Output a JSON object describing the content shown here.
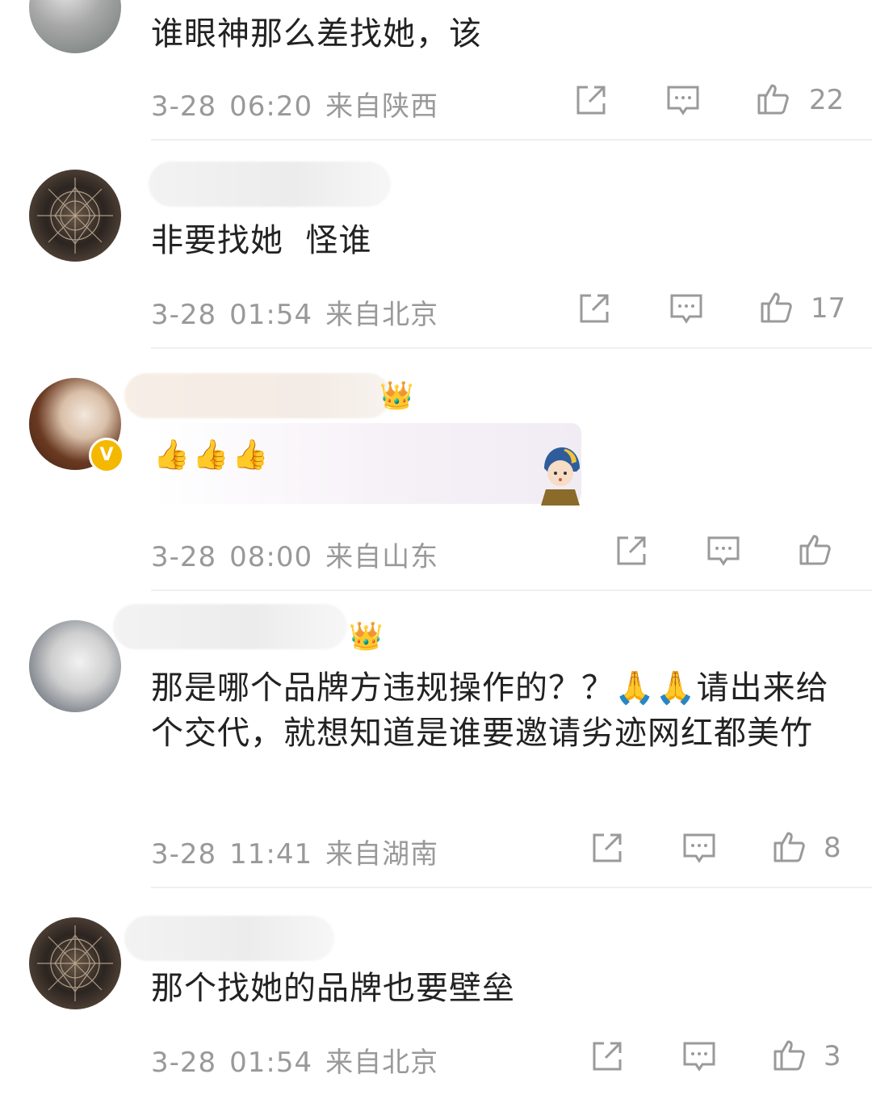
{
  "comments": [
    {
      "text": "谁眼神那么差找她，该",
      "date": "3-28",
      "time": "06:20",
      "location": "来自陕西",
      "likes": "22"
    },
    {
      "text": "非要找她  怪谁",
      "date": "3-28",
      "time": "01:54",
      "location": "来自北京",
      "likes": "17"
    },
    {
      "text": "👍👍👍",
      "date": "3-28",
      "time": "08:00",
      "location": "来自山东",
      "likes": ""
    },
    {
      "text": "那是哪个品牌方违规操作的？？🙏🙏请出来给个交代，就想知道是谁要邀请劣迹网红都美竹",
      "date": "3-28",
      "time": "11:41",
      "location": "来自湖南",
      "likes": "8"
    },
    {
      "text": "那个找她的品牌也要壁垒",
      "date": "3-28",
      "time": "01:54",
      "location": "来自北京",
      "likes": "3"
    }
  ],
  "icons": {
    "share": "share-icon",
    "comment": "comment-icon",
    "like": "thumbs-up-icon",
    "verified": "verified-badge-icon",
    "crown": "crown-icon"
  },
  "badge": {
    "verified_letter": "V"
  },
  "colors": {
    "meta": "#999999",
    "text": "#222222",
    "badge": "#f5b800"
  }
}
